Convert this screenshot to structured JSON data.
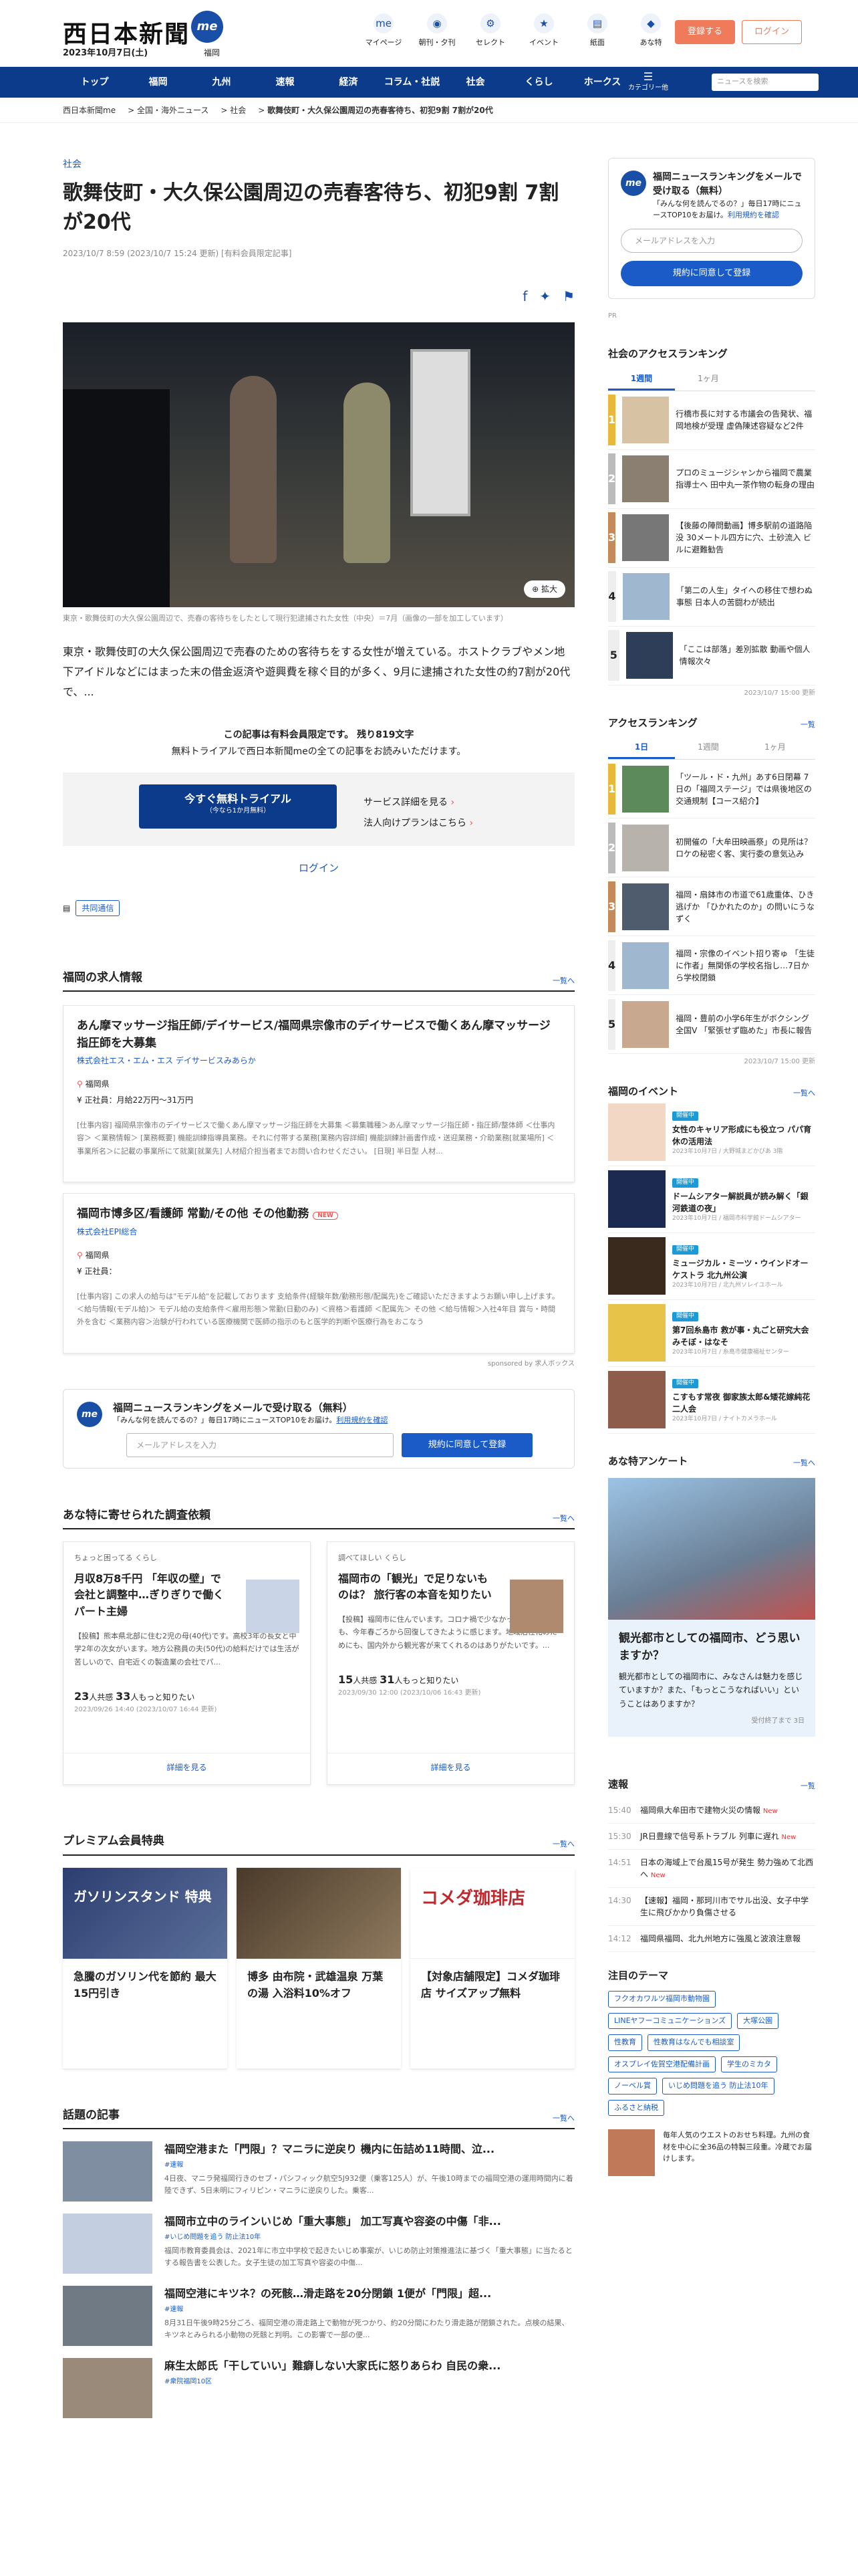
{
  "header": {
    "logo": "西日本新聞",
    "logo_badge": "me",
    "date": "2023年10月7日(土)",
    "region": "福岡",
    "icons": [
      {
        "label": "マイページ",
        "glyph": "me"
      },
      {
        "label": "朝刊・夕刊",
        "glyph": "◉"
      },
      {
        "label": "セレクト",
        "glyph": "⚙"
      },
      {
        "label": "イベント",
        "glyph": "★"
      },
      {
        "label": "紙面",
        "glyph": "▤"
      },
      {
        "label": "あな特",
        "glyph": "◆"
      }
    ],
    "register": "登録する",
    "login": "ログイン"
  },
  "nav": {
    "items": [
      "トップ",
      "福岡",
      "九州",
      "速報",
      "経済",
      "コラム・社説",
      "社会",
      "くらし",
      "ホークス"
    ],
    "menu_label": "カテゴリー他",
    "search_placeholder": "ニュースを検索"
  },
  "breadcrumb": [
    "西日本新聞me",
    "全国・海外ニュース",
    "社会",
    "歌舞伎町・大久保公園周辺の売春客待ち、初犯9割 7割が20代"
  ],
  "article": {
    "category": "社会",
    "title": "歌舞伎町・大久保公園周辺の売春客待ち、初犯9割 7割が20代",
    "meta": "2023/10/7 8:59 (2023/10/7 15:24 更新) [有料会員限定記事]",
    "zoom": "拡大",
    "caption": "東京・歌舞伎町の大久保公園周辺で、売春の客待ちをしたとして現行犯逮捕された女性（中央）＝7月（画像の一部を加工しています）",
    "lead": "東京・歌舞伎町の大久保公園周辺で売春のための客待ちをする女性が増えている。ホストクラブやメン地下アイドルなどにはまった末の借金返済や遊興費を稼ぐ目的が多く、9月に逮捕された女性の約7割が20代で、...",
    "paywall_1": "この記事は有料会員限定です。 残り819文字",
    "paywall_2": "無料トライアルで西日本新聞meの全ての記事をお読みいただけます。",
    "trial_button": "今すぐ無料トライアル",
    "trial_sub": "（今なら1か月無料）",
    "link_service": "サービス詳細を見る",
    "link_corp": "法人向けプランはこちら",
    "login_link": "ログイン",
    "tag": "共同通信"
  },
  "jobs": {
    "heading": "福岡の求人情報",
    "more": "一覧へ",
    "items": [
      {
        "title": "あん摩マッサージ指圧師/デイサービス/福岡県宗像市のデイサービスで働くあん摩マッサージ指圧師を大募集",
        "company": "株式会社エス・エム・エス デイサービスみあらか",
        "loc": "福岡県",
        "pay": "正社員：月給22万円〜31万円",
        "desc": "[仕事内容] 福岡県宗像市のデイサービスで働くあん摩マッサージ指圧師を大募集 ＜募集職種＞あん摩マッサージ指圧師・指圧師/整体師 ＜仕事内容＞ ＜業務情報＞ [業務概要] 機能訓練指導員業務。それに付帯する業務[業務内容詳細] 機能訓練計画書作成・送迎業務・介助業務[就業場所] ＜事業所名＞に記載の事業所にて就業[就業先] 人材紹介担当者までお問い合わせください。 [日現] 半日型 人材..."
      },
      {
        "title": "福岡市博多区/看護師 常勤/その他 その他勤務",
        "company": "株式会社EPI総合",
        "loc": "福岡県",
        "pay": "正社員：",
        "desc": "[仕事内容] この求人の給与は\"モデル給\"を記載しております 支給条件(経験年数/勤務形態/配属先)をご確認いただきますようお願い申し上げます。＜給与情報(モデル給)＞ モデル給の支給条件＜雇用形態＞常勤(日勤のみ) ＜資格＞看護師 ＜配属先＞ その他 ＜給与情報＞入社4年目 賞与・時間外を含む ＜業務内容＞治験が行われている医療機関で医師の指示のもと医学的判断や医療行為をおこなう"
      }
    ],
    "new_badge": "NEW",
    "sponsor": "sponsored by 求人ボックス"
  },
  "mail_main": {
    "title": "福岡ニュースランキングをメールで受け取る（無料）",
    "sub": "「みんな何を読んでるの？」毎日17時にニュースTOP10をお届け。",
    "terms": "利用規約を確認",
    "placeholder": "メールアドレスを入力",
    "button": "規約に同意して登録"
  },
  "surveys": {
    "heading": "あな特に寄せられた調査依頼",
    "more": "一覧へ",
    "items": [
      {
        "who": "ちょっと困ってる くらし",
        "title": "月収8万8千円 「年収の壁」で会社と調整中…ぎりぎりで働くパート主婦",
        "desc": "【投稿】熊本県北部に住む2児の母(40代)です。高校3年の長女と中学2年の次女がいます。地方公務員の夫(50代)の給料だけでは生活が苦しいので、自宅近くの製造業の会社でパ...",
        "likes": "23",
        "lab1": "人共感",
        "comments": "33",
        "lab2": "人もっと知りたい",
        "date": "2023/09/26 14:40 (2023/10/07 16:44 更新)",
        "btn": "詳細を見る"
      },
      {
        "who": "調べてほしい くらし",
        "title": "福岡市の「観光」で足りないものは？ 旅行客の本音を知りたい",
        "desc": "【投稿】福岡市に住んでいます。コロナ禍で少なかった観光客の姿も、今年春ごろから回復してきたように感じます。地域活性化のためにも、国内外から観光客が来てくれるのはありがたいです。...",
        "likes": "15",
        "lab1": "人共感",
        "comments": "31",
        "lab2": "人もっと知りたい",
        "date": "2023/09/30 12:00 (2023/10/06 16:43 更新)",
        "btn": "詳細を見る"
      }
    ]
  },
  "premium": {
    "heading": "プレミアム会員特典",
    "more": "一覧へ",
    "items": [
      {
        "img_text": "ガソリンスタンド 特典",
        "title": "急騰のガソリン代を節約 最大15円引き"
      },
      {
        "img_text": "",
        "title": "博多 由布院・武雄温泉 万葉の湯 入浴料10%オフ"
      },
      {
        "img_text": "コメダ珈琲店",
        "title": "【対象店舗限定】コメダ珈琲店 サイズアップ無料"
      }
    ]
  },
  "topics": {
    "heading": "話題の記事",
    "more": "一覧へ",
    "items": [
      {
        "title": "福岡空港また「門限」？マニラに逆戻り 機内に缶詰め11時間、泣...",
        "tag": "#速報",
        "desc": "4日夜、マニラ発福岡行きのセブ・パシフィック航空5J932便（乗客125人）が、午後10時までの福岡空港の運用時間内に着陸できず、5日未明にフィリピン・マニラに逆戻りした。乗客..."
      },
      {
        "title": "福岡市立中のラインいじめ「重大事態」 加工写真や容姿の中傷「非...",
        "tag": "#いじめ問題を追う 防止法10年",
        "desc": "福岡市教育委員会は、2021年に市立中学校で起きたいじめ事案が、いじめ防止対策推進法に基づく「重大事態」に当たるとする報告書を公表した。女子生徒の加工写真や容姿の中傷..."
      },
      {
        "title": "福岡空港にキツネ？の死骸…滑走路を20分閉鎖 1便が「門限」超...",
        "tag": "#速報",
        "desc": "8月31日午後9時25分ごろ、福岡空港の滑走路上で動物が死つかり、約20分間にわたり滑走路が閉鎖された。点検の結果、キツネとみられる小動物の死骸と判明。この影響で一部の便..."
      },
      {
        "title": "麻生太郎氏「干していい」難癖しない大家氏に怒りあらわ 自民の衆...",
        "tag": "#衆院福岡10区",
        "desc": ""
      }
    ]
  },
  "side": {
    "mail": {
      "title": "福岡ニュースランキングをメールで受け取る（無料）",
      "sub": "「みんな何を読んでるの？」毎日17時にニュースTOP10をお届け。",
      "terms": "利用規約を確認",
      "placeholder": "メールアドレスを入力",
      "button": "規約に同意して登録"
    },
    "pr": "PR",
    "social": {
      "heading": "社会のアクセスランキング",
      "tab1": "1週間",
      "tab2": "1ヶ月",
      "items": [
        "行橋市長に対する市議会の告発状、福岡地検が受理 虚偽陳述容疑など2件",
        "プロのミュージシャンから福岡で農業指導士へ 田中丸一茶作物の転身の理由",
        "【後藤の陣問動画】博多駅前の道路陥没 30メートル四方に穴、土砂流入 ビルに避難勧告",
        "「第二の人生」タイへの移住で想わぬ事態 日本人の苦闘わが続出",
        "「ここは部落」差別拡散 動画や個人情報次々"
      ],
      "updated": "2023/10/7 15:00 更新"
    },
    "access": {
      "heading": "アクセスランキング",
      "more": "一覧",
      "tab1": "1日",
      "tab2": "1週間",
      "tab3": "1ヶ月",
      "items": [
        "「ツール・ド・九州」あす6日閉幕 7日の「福岡ステージ」では県後地区の交通規制【コース紹介】",
        "初開催の「大牟田映画祭」の見所は？ ロケの秘密く客、実行委の意気込み",
        "福岡・扇鉢市の市道で61歳重体、ひき逃げか 「ひかれたのか」の問いにうなずく",
        "福岡・宗像のイベント招り寄ゅ 「生徒に作者」無関係の学校名指し…7日から学校閉鎖",
        "福岡・豊前の小学6年生がボクシング全国V 「緊張せず臨めた」市長に報告"
      ],
      "updated": "2023/10/7 15:00 更新"
    },
    "events": {
      "heading": "福岡のイベント",
      "more": "一覧へ",
      "badge": "開催中",
      "items": [
        {
          "title": "女性のキャリア形成にも役立つ パパ育休の活用法",
          "date": "2023年10月7日 / 大野城まどかぴあ 3階"
        },
        {
          "title": "ドームシアター解説員が読み解く「銀河鉄道の夜」",
          "date": "2023年10月7日 / 福岡市科学館ドームシアター"
        },
        {
          "title": "ミュージカル・ミーツ・ウインドオーケストラ 北九州公演",
          "date": "2023年10月7日 / 北九州ソレイユホール"
        },
        {
          "title": "第7回糸島市 救が事・丸ごと研究大会 みそぼ・はなそ",
          "date": "2023年10月7日 / 糸島市健康福祉センター"
        },
        {
          "title": "こすもす常夜 御家族太郎&矮花嫁純花 二人会",
          "date": "2023年10月7日 / ナイトカメラホール"
        }
      ]
    },
    "enquete": {
      "heading": "あな特アンケート",
      "more": "一覧へ",
      "title": "観光都市としての福岡市、どう思いますか？",
      "text": "観光都市としての福岡市に、みなさんは魅力を感じていますか？また、「もっとこうなればいい」ということはありますか？",
      "date": "受付終了まで 3日"
    },
    "flash": {
      "heading": "速報",
      "more": "一覧",
      "items": [
        {
          "time": "15:40",
          "text": "福岡県大牟田市で建物火災の情報",
          "new": "New"
        },
        {
          "time": "15:30",
          "text": "JR日豊線で信号系トラブル 列車に遅れ",
          "new": "New"
        },
        {
          "time": "14:51",
          "text": "日本の海域上で台風15号が発生 勢力強めて北西へ",
          "new": "New"
        },
        {
          "time": "14:30",
          "text": "【速報】福岡・那珂川市でサル出没、女子中学生に飛びかかり負傷させる",
          "new": ""
        },
        {
          "time": "14:12",
          "text": "福岡県福岡、北九州地方に強風と波浪注意報",
          "new": ""
        }
      ]
    },
    "themes": {
      "heading": "注目のテーマ",
      "items": [
        "フクオカワルツ福岡市動物園",
        "LINEヤフーコミュニケーションズ",
        "大塚公園",
        "性教育",
        "性教育はなんでも相談室",
        "オスプレイ佐賀空港配備計画",
        "学生のミカタ",
        "ノーベル賞",
        "いじめ問題を追う 防止法10年",
        "ふるさと納税"
      ]
    },
    "radio": "毎年人気のウエストのおせち料理。九州の食材を中心に全36品の特製三段重。冷蔵でお届けします。"
  }
}
